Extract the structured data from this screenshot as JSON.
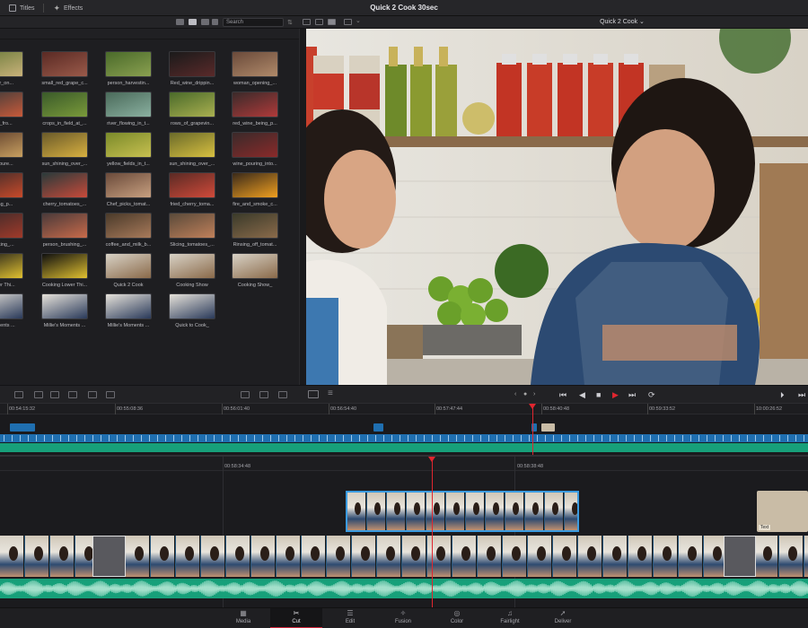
{
  "top": {
    "tabs": [
      {
        "label": "Titles",
        "icon": "titles-icon"
      },
      {
        "label": "Effects",
        "icon": "effects-icon"
      }
    ],
    "project_title": "Quick 2 Cook 30sec"
  },
  "pool_toolbar": {
    "search_placeholder": "Search"
  },
  "viewer": {
    "clip_name": "Quick 2 Cook ⌄"
  },
  "clips": [
    {
      "name": "cluster_on..."
    },
    {
      "name": "small_red_grape_c..."
    },
    {
      "name": "person_harvestin..."
    },
    {
      "name": "Red_wine_drippin..."
    },
    {
      "name": "woman_opening_..."
    },
    {
      "name": "...ling_fro..."
    },
    {
      "name": "crops_in_field_at_..."
    },
    {
      "name": "river_flowing_in_t..."
    },
    {
      "name": "rows_of_grapevin..."
    },
    {
      "name": "red_wine_being_p..."
    },
    {
      "name": "...g_poure..."
    },
    {
      "name": "sun_shining_over_..."
    },
    {
      "name": "yellow_fields_in_t..."
    },
    {
      "name": "sun_shining_over_..."
    },
    {
      "name": "wine_pouring_into..."
    },
    {
      "name": "...being_p..."
    },
    {
      "name": "cherry_tomatoes_..."
    },
    {
      "name": "Chef_picks_tomat..."
    },
    {
      "name": "fried_cherry_toma..."
    },
    {
      "name": "fire_and_smoke_c..."
    },
    {
      "name": "...cooking_..."
    },
    {
      "name": "person_brushing_..."
    },
    {
      "name": "coffee_and_milk_b..."
    },
    {
      "name": "Slicing_tomatoes_..."
    },
    {
      "name": "Rinsing_off_tomat..."
    },
    {
      "name": "...Lower Thi..."
    },
    {
      "name": "Cooking Lower Thi..."
    },
    {
      "name": "Quick 2 Cook"
    },
    {
      "name": "Cooking Show"
    },
    {
      "name": "Cooking Show_"
    },
    {
      "name": "...Moments ..."
    },
    {
      "name": "Millie's Moments ..."
    },
    {
      "name": "Millie's Moments ..."
    },
    {
      "name": "Quick to Cook_"
    }
  ],
  "timeline_upper": {
    "timecodes": [
      "00:54:15:32",
      "00:55:08:36",
      "00:56:01:40",
      "00:56:54:40",
      "00:57:47:44",
      "00:58:40:48",
      "00:59:33:52",
      "10:00:26:52"
    ]
  },
  "timeline_lower": {
    "timecodes": [
      "00:58:34:48",
      "00:58:38:48"
    ],
    "title_clip_label": "Text"
  },
  "pages": [
    {
      "label": "Media",
      "icon": "media-icon"
    },
    {
      "label": "Cut",
      "icon": "cut-icon"
    },
    {
      "label": "Edit",
      "icon": "edit-icon"
    },
    {
      "label": "Fusion",
      "icon": "fusion-icon"
    },
    {
      "label": "Color",
      "icon": "color-icon"
    },
    {
      "label": "Fairlight",
      "icon": "fairlight-icon"
    },
    {
      "label": "Deliver",
      "icon": "deliver-icon"
    }
  ],
  "active_page": "Cut",
  "colors": {
    "accent_red": "#e0262f",
    "video_track_blue": "#1f6fb0",
    "audio_track_green": "#17a07a",
    "selected_clip_border": "#3b9be0"
  }
}
